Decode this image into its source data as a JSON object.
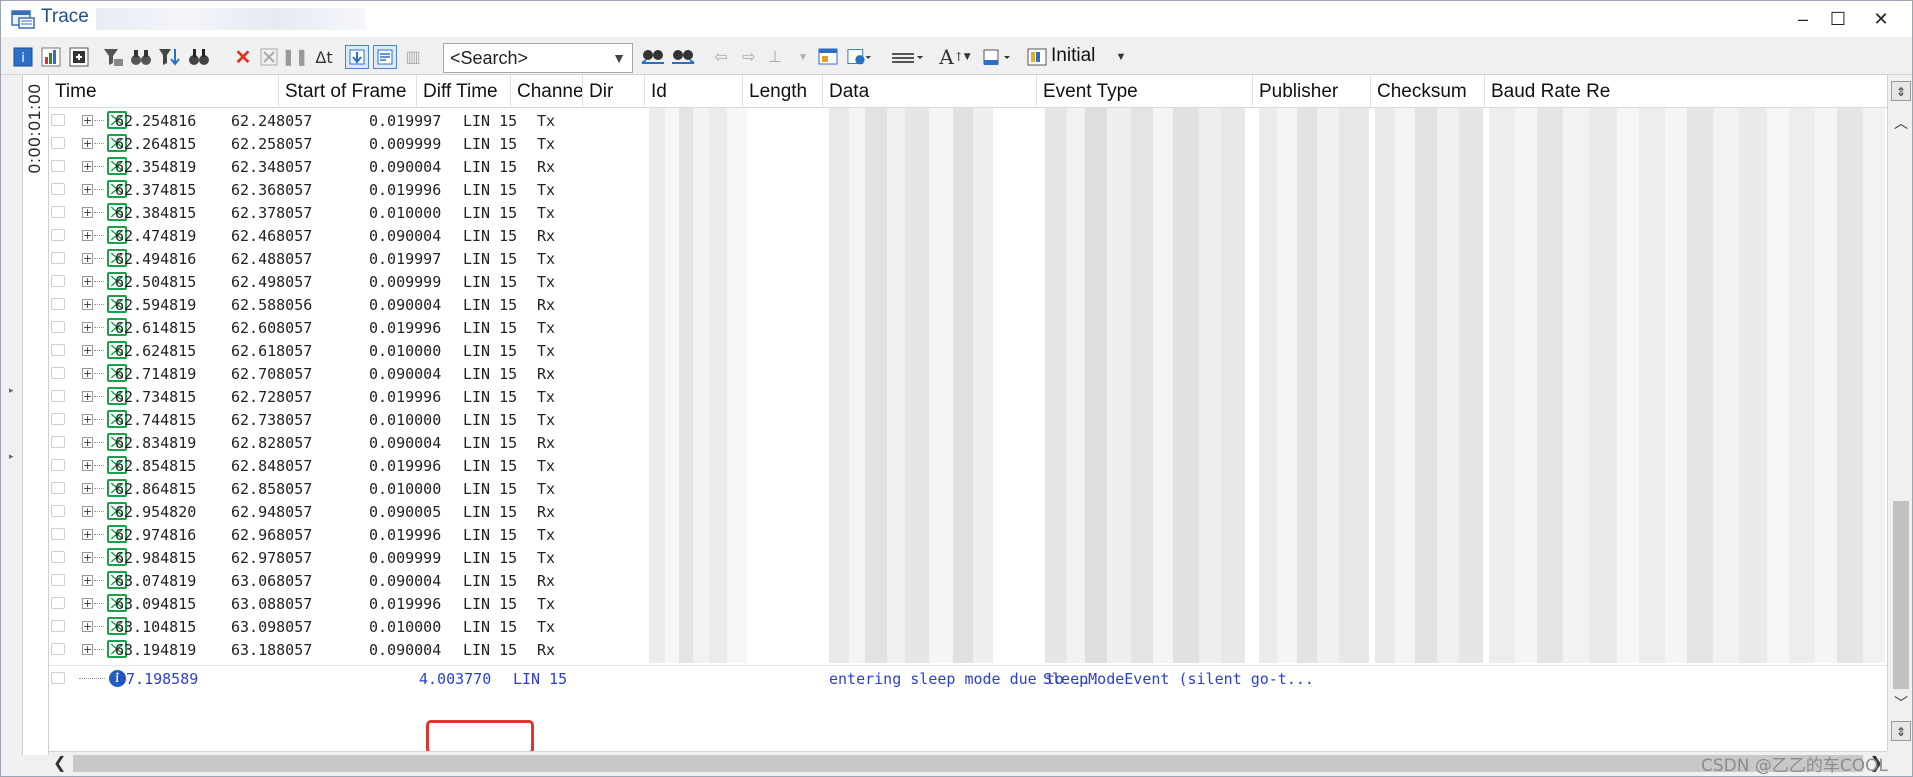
{
  "window": {
    "title": "Trace",
    "minimize": "–",
    "maximize": "☐",
    "close": "✕"
  },
  "toolbar": {
    "search_placeholder": "<Search>",
    "filter_label": "Initial",
    "delta_label": "Δt"
  },
  "timebar": {
    "label": "0:00:01:00"
  },
  "columns": [
    "Time",
    "Start of Frame",
    "Diff Time",
    "Channel",
    "Dir",
    "Id",
    "Length",
    "Data",
    "Event Type",
    "Publisher",
    "Checksum",
    "Baud Rate Re"
  ],
  "rows": [
    {
      "time": "62.254816",
      "sof": "62.248057",
      "diff": "0.019997",
      "channel": "LIN 15",
      "dir": "Tx"
    },
    {
      "time": "62.264815",
      "sof": "62.258057",
      "diff": "0.009999",
      "channel": "LIN 15",
      "dir": "Tx"
    },
    {
      "time": "62.354819",
      "sof": "62.348057",
      "diff": "0.090004",
      "channel": "LIN 15",
      "dir": "Rx"
    },
    {
      "time": "62.374815",
      "sof": "62.368057",
      "diff": "0.019996",
      "channel": "LIN 15",
      "dir": "Tx"
    },
    {
      "time": "62.384815",
      "sof": "62.378057",
      "diff": "0.010000",
      "channel": "LIN 15",
      "dir": "Tx"
    },
    {
      "time": "62.474819",
      "sof": "62.468057",
      "diff": "0.090004",
      "channel": "LIN 15",
      "dir": "Rx"
    },
    {
      "time": "62.494816",
      "sof": "62.488057",
      "diff": "0.019997",
      "channel": "LIN 15",
      "dir": "Tx"
    },
    {
      "time": "62.504815",
      "sof": "62.498057",
      "diff": "0.009999",
      "channel": "LIN 15",
      "dir": "Tx"
    },
    {
      "time": "62.594819",
      "sof": "62.588056",
      "diff": "0.090004",
      "channel": "LIN 15",
      "dir": "Rx"
    },
    {
      "time": "62.614815",
      "sof": "62.608057",
      "diff": "0.019996",
      "channel": "LIN 15",
      "dir": "Tx"
    },
    {
      "time": "62.624815",
      "sof": "62.618057",
      "diff": "0.010000",
      "channel": "LIN 15",
      "dir": "Tx"
    },
    {
      "time": "62.714819",
      "sof": "62.708057",
      "diff": "0.090004",
      "channel": "LIN 15",
      "dir": "Rx"
    },
    {
      "time": "62.734815",
      "sof": "62.728057",
      "diff": "0.019996",
      "channel": "LIN 15",
      "dir": "Tx"
    },
    {
      "time": "62.744815",
      "sof": "62.738057",
      "diff": "0.010000",
      "channel": "LIN 15",
      "dir": "Tx"
    },
    {
      "time": "62.834819",
      "sof": "62.828057",
      "diff": "0.090004",
      "channel": "LIN 15",
      "dir": "Rx"
    },
    {
      "time": "62.854815",
      "sof": "62.848057",
      "diff": "0.019996",
      "channel": "LIN 15",
      "dir": "Tx"
    },
    {
      "time": "62.864815",
      "sof": "62.858057",
      "diff": "0.010000",
      "channel": "LIN 15",
      "dir": "Tx"
    },
    {
      "time": "62.954820",
      "sof": "62.948057",
      "diff": "0.090005",
      "channel": "LIN 15",
      "dir": "Rx"
    },
    {
      "time": "62.974816",
      "sof": "62.968057",
      "diff": "0.019996",
      "channel": "LIN 15",
      "dir": "Tx"
    },
    {
      "time": "62.984815",
      "sof": "62.978057",
      "diff": "0.009999",
      "channel": "LIN 15",
      "dir": "Tx"
    },
    {
      "time": "63.074819",
      "sof": "63.068057",
      "diff": "0.090004",
      "channel": "LIN 15",
      "dir": "Rx"
    },
    {
      "time": "63.094815",
      "sof": "63.088057",
      "diff": "0.019996",
      "channel": "LIN 15",
      "dir": "Tx"
    },
    {
      "time": "63.104815",
      "sof": "63.098057",
      "diff": "0.010000",
      "channel": "LIN 15",
      "dir": "Tx"
    },
    {
      "time": "63.194819",
      "sof": "63.188057",
      "diff": "0.090004",
      "channel": "LIN 15",
      "dir": "Rx"
    }
  ],
  "last_row": {
    "time": "67.198589",
    "diff": "4.003770",
    "channel": "LIN 15",
    "data": "entering sleep mode due to ...",
    "event": "SleepModeEvent (silent go-t..."
  },
  "colors": {
    "highlight": "#e0342e",
    "event_text": "#2a3fd0",
    "message_icon": "#17a34a"
  },
  "watermark": "CSDN @乙乙的车COOL"
}
